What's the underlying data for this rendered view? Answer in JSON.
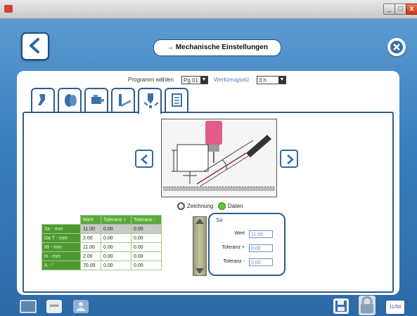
{
  "window": {
    "minimize": "_",
    "maximize": "□",
    "close": "x"
  },
  "header": {
    "title": "→ Mechanische Einstellungen"
  },
  "program_row": {
    "program_label": "Programm wählen",
    "program_value": "Pg 01",
    "second_label": "Werkzeugsatz",
    "second_value": "3 h"
  },
  "tabs": [
    {
      "icon": "torch-icon"
    },
    {
      "icon": "gas-nozzle-icon"
    },
    {
      "icon": "feeder-icon"
    },
    {
      "icon": "torch-angle-icon"
    },
    {
      "icon": "torch-position-icon",
      "active": true
    },
    {
      "icon": "document-icon"
    }
  ],
  "view_options": {
    "option1": "Zeichnung",
    "option2": "Daten",
    "selected": "Daten"
  },
  "table": {
    "headers": [
      "Wert",
      "Toleranz +",
      "Toleranz -"
    ],
    "rows": [
      {
        "label": "Se - mm",
        "values": [
          "11.00",
          "0.00",
          "0.00"
        ]
      },
      {
        "label": "Da T - mm",
        "values": [
          "2.00",
          "0.00",
          "0.00"
        ]
      },
      {
        "label": "Rt - mm",
        "values": [
          "11.00",
          "0.00",
          "0.00"
        ]
      },
      {
        "label": "H - mm",
        "values": [
          "2.00",
          "0.00",
          "0.00"
        ]
      },
      {
        "label": "A - °",
        "values": [
          "70.00",
          "0.00",
          "0.00"
        ]
      }
    ]
  },
  "detail": {
    "title": "Se",
    "fields": [
      {
        "label": "Wert",
        "value": "11.00"
      },
      {
        "label": "Toleranz +",
        "value": "0.00"
      },
      {
        "label": "Toleranz -",
        "value": "0.00"
      }
    ]
  },
  "bottom": {
    "small_btn": "www",
    "right_btn": "11/50"
  },
  "colors": {
    "brand_blue": "#2d6fa8",
    "table_green": "#5ba83c",
    "radio_green": "#6abf3d"
  }
}
